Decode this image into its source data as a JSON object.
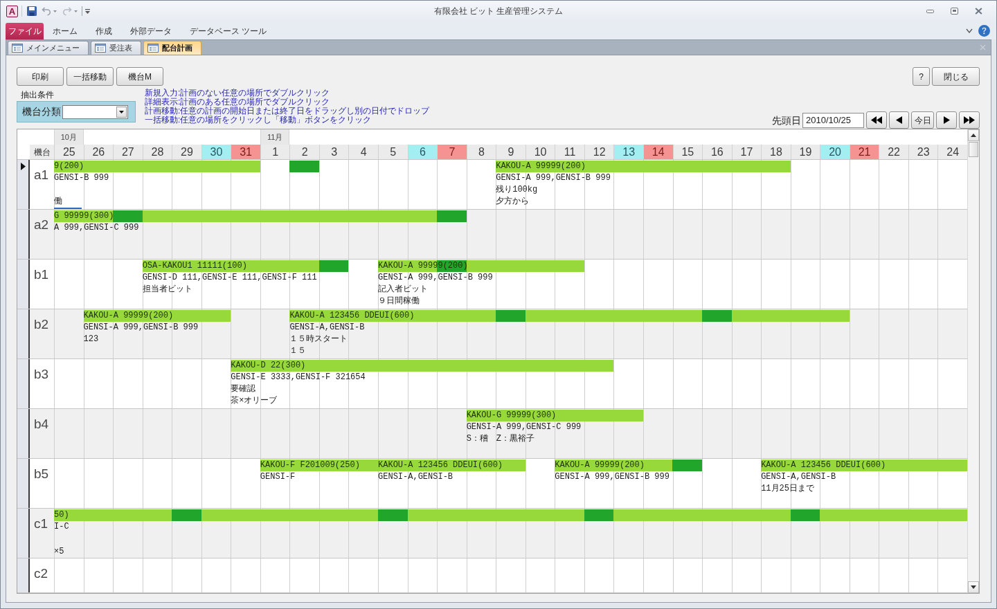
{
  "window": {
    "app_logo": "A",
    "title": "有限会社 ビット 生産管理システム"
  },
  "ribbon_tabs": [
    {
      "label": "ファイル",
      "kind": "backstage"
    },
    {
      "label": "ホーム",
      "kind": "tab"
    },
    {
      "label": "作成",
      "kind": "tab"
    },
    {
      "label": "外部データ",
      "kind": "tab"
    },
    {
      "label": "データベース ツール",
      "kind": "tab"
    }
  ],
  "document_tabs": [
    {
      "label": "メインメニュー",
      "selected": false
    },
    {
      "label": "受注表",
      "selected": false
    },
    {
      "label": "配台計画",
      "selected": true
    }
  ],
  "toolbar": {
    "left_buttons": [
      "印刷",
      "一括移動",
      "機台M"
    ],
    "right_buttons": [
      "?",
      "閉じる"
    ]
  },
  "filter": {
    "group_label": "抽出条件",
    "field_label": "機台分類"
  },
  "instructions": [
    "新規入力:計画のない任意の場所でダブルクリック",
    "詳細表示:計画のある任意の場所でダブルクリック",
    "計画移動:任意の計画の開始日または終了日をドラッグし別の日付でドロップ",
    "一括移動:任意の場所をクリックし「移動」ボタンをクリック"
  ],
  "start_date": {
    "label": "先頭日",
    "value": "2010/10/25"
  },
  "navigation": [
    {
      "kind": "first"
    },
    {
      "kind": "previous"
    },
    {
      "kind": "today",
      "label": "今日"
    },
    {
      "kind": "next"
    },
    {
      "kind": "last"
    }
  ],
  "grid": {
    "row_header": "機台",
    "days": [
      {
        "label": "25",
        "kind": "weekday",
        "month": "10月"
      },
      {
        "label": "26",
        "kind": "weekday"
      },
      {
        "label": "27",
        "kind": "weekday"
      },
      {
        "label": "28",
        "kind": "weekday"
      },
      {
        "label": "29",
        "kind": "weekday"
      },
      {
        "label": "30",
        "kind": "saturday"
      },
      {
        "label": "31",
        "kind": "sunday"
      },
      {
        "label": "1",
        "kind": "weekday",
        "month": "11月"
      },
      {
        "label": "2",
        "kind": "weekday"
      },
      {
        "label": "3",
        "kind": "weekday"
      },
      {
        "label": "4",
        "kind": "weekday"
      },
      {
        "label": "5",
        "kind": "weekday"
      },
      {
        "label": "6",
        "kind": "saturday"
      },
      {
        "label": "7",
        "kind": "sunday"
      },
      {
        "label": "8",
        "kind": "weekday"
      },
      {
        "label": "9",
        "kind": "weekday"
      },
      {
        "label": "10",
        "kind": "weekday"
      },
      {
        "label": "11",
        "kind": "weekday"
      },
      {
        "label": "12",
        "kind": "weekday"
      },
      {
        "label": "13",
        "kind": "saturday"
      },
      {
        "label": "14",
        "kind": "sunday"
      },
      {
        "label": "15",
        "kind": "weekday"
      },
      {
        "label": "16",
        "kind": "weekday"
      },
      {
        "label": "17",
        "kind": "weekday"
      },
      {
        "label": "18",
        "kind": "weekday"
      },
      {
        "label": "19",
        "kind": "weekday"
      },
      {
        "label": "20",
        "kind": "saturday"
      },
      {
        "label": "21",
        "kind": "sunday"
      },
      {
        "label": "22",
        "kind": "weekday"
      },
      {
        "label": "23",
        "kind": "weekday"
      },
      {
        "label": "24",
        "kind": "weekday"
      }
    ],
    "rows": [
      {
        "label": "a1",
        "current": true,
        "cells": [
          {
            "kind": "start"
          },
          {
            "kind": "bar"
          },
          {
            "kind": "bar"
          },
          {
            "kind": "bar"
          },
          {
            "kind": "bar"
          },
          {
            "kind": "bar"
          },
          {
            "kind": "bar"
          },
          {
            "kind": "none"
          },
          {
            "kind": "dark"
          },
          {
            "kind": "none"
          },
          {
            "kind": "none"
          },
          {
            "kind": "none"
          },
          {
            "kind": "none"
          },
          {
            "kind": "none"
          },
          {
            "kind": "none"
          },
          {
            "kind": "start"
          },
          {
            "kind": "bar"
          },
          {
            "kind": "bar"
          },
          {
            "kind": "bar"
          },
          {
            "kind": "bar"
          },
          {
            "kind": "bar"
          },
          {
            "kind": "bar"
          },
          {
            "kind": "bar"
          },
          {
            "kind": "bar"
          },
          {
            "kind": "bar"
          },
          {
            "kind": "none"
          },
          {
            "kind": "none"
          },
          {
            "kind": "none"
          },
          {
            "kind": "none"
          },
          {
            "kind": "none"
          },
          {
            "kind": "none"
          }
        ],
        "plans": [
          {
            "label": "9(200)",
            "focused": true,
            "notes": [
              "GENSI-B 999"
            ],
            "bottom_note": "働"
          },
          {
            "label": "KAKOU-A 99999(200)",
            "focused": false,
            "notes": [
              "GENSI-A 999,GENSI-B 999",
              "残り100kg",
              "夕方から"
            ]
          }
        ]
      },
      {
        "label": "a2",
        "current": false,
        "cells": [
          {
            "kind": "start"
          },
          {
            "kind": "bar"
          },
          {
            "kind": "dark"
          },
          {
            "kind": "bar"
          },
          {
            "kind": "bar"
          },
          {
            "kind": "bar"
          },
          {
            "kind": "bar"
          },
          {
            "kind": "bar"
          },
          {
            "kind": "bar"
          },
          {
            "kind": "bar"
          },
          {
            "kind": "bar"
          },
          {
            "kind": "bar"
          },
          {
            "kind": "bar"
          },
          {
            "kind": "dark"
          },
          {
            "kind": "none"
          },
          {
            "kind": "none"
          },
          {
            "kind": "none"
          },
          {
            "kind": "none"
          },
          {
            "kind": "none"
          },
          {
            "kind": "none"
          },
          {
            "kind": "none"
          },
          {
            "kind": "none"
          },
          {
            "kind": "none"
          },
          {
            "kind": "none"
          },
          {
            "kind": "none"
          },
          {
            "kind": "none"
          },
          {
            "kind": "none"
          },
          {
            "kind": "none"
          },
          {
            "kind": "none"
          },
          {
            "kind": "none"
          },
          {
            "kind": "none"
          }
        ],
        "plans": [
          {
            "label": "G 99999(300)",
            "focused": false,
            "notes": [
              "A 999,GENSI-C 999"
            ]
          }
        ]
      },
      {
        "label": "b1",
        "current": false,
        "cells": [
          {
            "kind": "none"
          },
          {
            "kind": "none"
          },
          {
            "kind": "none"
          },
          {
            "kind": "start"
          },
          {
            "kind": "bar"
          },
          {
            "kind": "bar"
          },
          {
            "kind": "bar"
          },
          {
            "kind": "bar"
          },
          {
            "kind": "bar"
          },
          {
            "kind": "dark"
          },
          {
            "kind": "none"
          },
          {
            "kind": "start"
          },
          {
            "kind": "bar"
          },
          {
            "kind": "dark"
          },
          {
            "kind": "bar"
          },
          {
            "kind": "bar"
          },
          {
            "kind": "bar"
          },
          {
            "kind": "bar"
          },
          {
            "kind": "none"
          },
          {
            "kind": "none"
          },
          {
            "kind": "none"
          },
          {
            "kind": "none"
          },
          {
            "kind": "none"
          },
          {
            "kind": "none"
          },
          {
            "kind": "none"
          },
          {
            "kind": "none"
          },
          {
            "kind": "none"
          },
          {
            "kind": "none"
          },
          {
            "kind": "none"
          },
          {
            "kind": "none"
          },
          {
            "kind": "none"
          }
        ],
        "plans": [
          {
            "label": "OSA-KAKOU1 11111(100)",
            "focused": false,
            "notes": [
              "GENSI-D 111,GENSI-E 111,GENSI-F 111",
              "担当者ビット"
            ]
          },
          {
            "label": "KAKOU-A 99999(200)",
            "focused": false,
            "notes": [
              "GENSI-A 999,GENSI-B 999",
              "記入者ビット",
              "９日間稼働"
            ]
          }
        ]
      },
      {
        "label": "b2",
        "current": false,
        "cells": [
          {
            "kind": "none"
          },
          {
            "kind": "start"
          },
          {
            "kind": "bar"
          },
          {
            "kind": "bar"
          },
          {
            "kind": "bar"
          },
          {
            "kind": "bar"
          },
          {
            "kind": "none"
          },
          {
            "kind": "none"
          },
          {
            "kind": "start"
          },
          {
            "kind": "bar"
          },
          {
            "kind": "bar"
          },
          {
            "kind": "bar"
          },
          {
            "kind": "bar"
          },
          {
            "kind": "bar"
          },
          {
            "kind": "bar"
          },
          {
            "kind": "dark"
          },
          {
            "kind": "bar"
          },
          {
            "kind": "bar"
          },
          {
            "kind": "bar"
          },
          {
            "kind": "bar"
          },
          {
            "kind": "bar"
          },
          {
            "kind": "bar"
          },
          {
            "kind": "dark"
          },
          {
            "kind": "bar"
          },
          {
            "kind": "bar"
          },
          {
            "kind": "bar"
          },
          {
            "kind": "bar"
          },
          {
            "kind": "none"
          },
          {
            "kind": "none"
          },
          {
            "kind": "none"
          },
          {
            "kind": "none"
          }
        ],
        "plans": [
          {
            "label": "KAKOU-A 99999(200)",
            "focused": false,
            "notes": [
              "GENSI-A 999,GENSI-B 999",
              "123"
            ]
          },
          {
            "label": "KAKOU-A 123456 DDEUI(600)",
            "focused": false,
            "notes": [
              "GENSI-A,GENSI-B",
              "１５時スタート",
              "１５"
            ]
          }
        ]
      },
      {
        "label": "b3",
        "current": false,
        "cells": [
          {
            "kind": "none"
          },
          {
            "kind": "none"
          },
          {
            "kind": "none"
          },
          {
            "kind": "none"
          },
          {
            "kind": "none"
          },
          {
            "kind": "none"
          },
          {
            "kind": "start"
          },
          {
            "kind": "bar"
          },
          {
            "kind": "bar"
          },
          {
            "kind": "bar"
          },
          {
            "kind": "bar"
          },
          {
            "kind": "bar"
          },
          {
            "kind": "bar"
          },
          {
            "kind": "bar"
          },
          {
            "kind": "bar"
          },
          {
            "kind": "bar"
          },
          {
            "kind": "bar"
          },
          {
            "kind": "bar"
          },
          {
            "kind": "bar"
          },
          {
            "kind": "none"
          },
          {
            "kind": "none"
          },
          {
            "kind": "none"
          },
          {
            "kind": "none"
          },
          {
            "kind": "none"
          },
          {
            "kind": "none"
          },
          {
            "kind": "none"
          },
          {
            "kind": "none"
          },
          {
            "kind": "none"
          },
          {
            "kind": "none"
          },
          {
            "kind": "none"
          },
          {
            "kind": "none"
          }
        ],
        "plans": [
          {
            "label": "KAKOU-D 22(300)",
            "focused": false,
            "notes": [
              "GENSI-E 3333,GENSI-F 321654",
              "要確認",
              "茶×オリーブ"
            ]
          }
        ]
      },
      {
        "label": "b4",
        "current": false,
        "cells": [
          {
            "kind": "none"
          },
          {
            "kind": "none"
          },
          {
            "kind": "none"
          },
          {
            "kind": "none"
          },
          {
            "kind": "none"
          },
          {
            "kind": "none"
          },
          {
            "kind": "none"
          },
          {
            "kind": "none"
          },
          {
            "kind": "none"
          },
          {
            "kind": "none"
          },
          {
            "kind": "none"
          },
          {
            "kind": "none"
          },
          {
            "kind": "none"
          },
          {
            "kind": "none"
          },
          {
            "kind": "start"
          },
          {
            "kind": "bar"
          },
          {
            "kind": "bar"
          },
          {
            "kind": "bar"
          },
          {
            "kind": "bar"
          },
          {
            "kind": "bar"
          },
          {
            "kind": "none"
          },
          {
            "kind": "none"
          },
          {
            "kind": "none"
          },
          {
            "kind": "none"
          },
          {
            "kind": "none"
          },
          {
            "kind": "none"
          },
          {
            "kind": "none"
          },
          {
            "kind": "none"
          },
          {
            "kind": "none"
          },
          {
            "kind": "none"
          },
          {
            "kind": "none"
          }
        ],
        "plans": [
          {
            "label": "KAKOU-G 99999(300)",
            "focused": false,
            "notes": [
              "GENSI-A 999,GENSI-C 999",
              "S：稽　Z：黒裕子"
            ]
          }
        ]
      },
      {
        "label": "b5",
        "current": false,
        "cells": [
          {
            "kind": "none"
          },
          {
            "kind": "none"
          },
          {
            "kind": "none"
          },
          {
            "kind": "none"
          },
          {
            "kind": "none"
          },
          {
            "kind": "none"
          },
          {
            "kind": "none"
          },
          {
            "kind": "start"
          },
          {
            "kind": "bar"
          },
          {
            "kind": "bar"
          },
          {
            "kind": "bar"
          },
          {
            "kind": "start"
          },
          {
            "kind": "bar"
          },
          {
            "kind": "bar"
          },
          {
            "kind": "bar"
          },
          {
            "kind": "bar"
          },
          {
            "kind": "none"
          },
          {
            "kind": "start"
          },
          {
            "kind": "bar"
          },
          {
            "kind": "bar"
          },
          {
            "kind": "bar"
          },
          {
            "kind": "dark"
          },
          {
            "kind": "none"
          },
          {
            "kind": "none"
          },
          {
            "kind": "start"
          },
          {
            "kind": "bar"
          },
          {
            "kind": "bar"
          },
          {
            "kind": "bar"
          },
          {
            "kind": "bar"
          },
          {
            "kind": "bar"
          },
          {
            "kind": "bar"
          }
        ],
        "plans": [
          {
            "label": "KAKOU-F F201009(250)",
            "focused": false,
            "notes": [
              "GENSI-F"
            ]
          },
          {
            "label": "KAKOU-A 123456 DDEUI(600)",
            "focused": false,
            "notes": [
              "GENSI-A,GENSI-B"
            ]
          },
          {
            "label": "KAKOU-A 99999(200)",
            "focused": false,
            "notes": [
              "GENSI-A 999,GENSI-B 999"
            ]
          },
          {
            "label": "KAKOU-A 123456 DDEUI(600)",
            "focused": false,
            "notes": [
              "GENSI-A,GENSI-B",
              "11月25日まで"
            ]
          }
        ]
      },
      {
        "label": "c1",
        "current": false,
        "cells": [
          {
            "kind": "start"
          },
          {
            "kind": "bar"
          },
          {
            "kind": "bar"
          },
          {
            "kind": "bar"
          },
          {
            "kind": "dark"
          },
          {
            "kind": "bar"
          },
          {
            "kind": "bar"
          },
          {
            "kind": "bar"
          },
          {
            "kind": "bar"
          },
          {
            "kind": "bar"
          },
          {
            "kind": "bar"
          },
          {
            "kind": "dark"
          },
          {
            "kind": "bar"
          },
          {
            "kind": "bar"
          },
          {
            "kind": "bar"
          },
          {
            "kind": "bar"
          },
          {
            "kind": "bar"
          },
          {
            "kind": "bar"
          },
          {
            "kind": "dark"
          },
          {
            "kind": "bar"
          },
          {
            "kind": "bar"
          },
          {
            "kind": "bar"
          },
          {
            "kind": "bar"
          },
          {
            "kind": "bar"
          },
          {
            "kind": "bar"
          },
          {
            "kind": "dark"
          },
          {
            "kind": "bar"
          },
          {
            "kind": "bar"
          },
          {
            "kind": "bar"
          },
          {
            "kind": "bar"
          },
          {
            "kind": "bar"
          }
        ],
        "plans": [
          {
            "label": "50)",
            "focused": false,
            "notes": [
              "I-C"
            ],
            "bottom_note": "×5"
          }
        ]
      },
      {
        "label": "c2",
        "current": false,
        "cells": [
          {
            "kind": "none"
          },
          {
            "kind": "none"
          },
          {
            "kind": "none"
          },
          {
            "kind": "none"
          },
          {
            "kind": "none"
          },
          {
            "kind": "none"
          },
          {
            "kind": "none"
          },
          {
            "kind": "none"
          },
          {
            "kind": "none"
          },
          {
            "kind": "none"
          },
          {
            "kind": "none"
          },
          {
            "kind": "none"
          },
          {
            "kind": "none"
          },
          {
            "kind": "none"
          },
          {
            "kind": "none"
          },
          {
            "kind": "none"
          },
          {
            "kind": "none"
          },
          {
            "kind": "none"
          },
          {
            "kind": "none"
          },
          {
            "kind": "none"
          },
          {
            "kind": "none"
          },
          {
            "kind": "none"
          },
          {
            "kind": "none"
          },
          {
            "kind": "none"
          },
          {
            "kind": "none"
          },
          {
            "kind": "none"
          },
          {
            "kind": "none"
          },
          {
            "kind": "none"
          },
          {
            "kind": "none"
          },
          {
            "kind": "none"
          },
          {
            "kind": "none"
          }
        ]
      }
    ]
  }
}
